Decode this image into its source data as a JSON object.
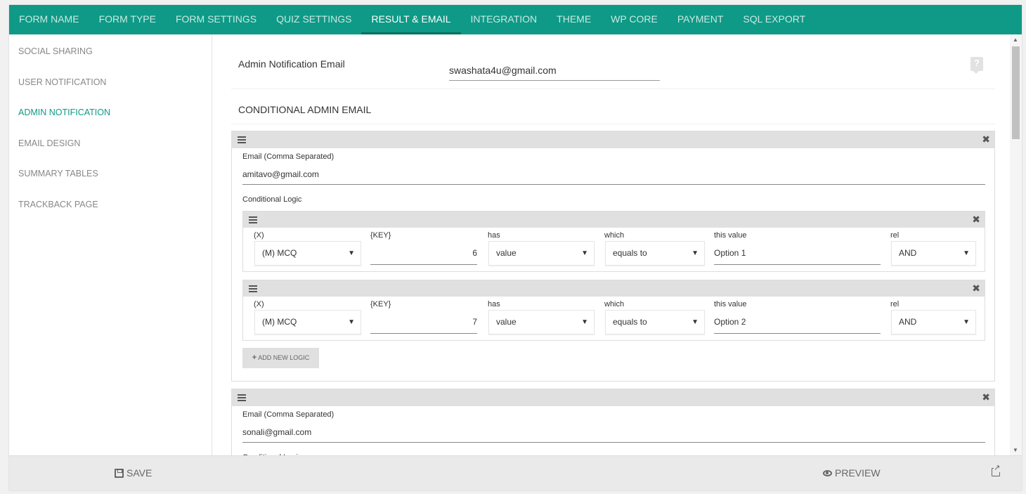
{
  "tabs": [
    {
      "label": "FORM NAME"
    },
    {
      "label": "FORM TYPE"
    },
    {
      "label": "FORM SETTINGS"
    },
    {
      "label": "QUIZ SETTINGS"
    },
    {
      "label": "RESULT & EMAIL",
      "active": true
    },
    {
      "label": "INTEGRATION"
    },
    {
      "label": "THEME"
    },
    {
      "label": "WP CORE"
    },
    {
      "label": "PAYMENT"
    },
    {
      "label": "SQL EXPORT"
    }
  ],
  "sidebar": {
    "items": [
      {
        "label": "SOCIAL SHARING"
      },
      {
        "label": "USER NOTIFICATION"
      },
      {
        "label": "ADMIN NOTIFICATION",
        "active": true
      },
      {
        "label": "EMAIL DESIGN"
      },
      {
        "label": "SUMMARY TABLES"
      },
      {
        "label": "TRACKBACK PAGE"
      }
    ]
  },
  "admin": {
    "label": "Admin Notification Email",
    "value": "swashata4u@gmail.com",
    "help_icon": "?"
  },
  "conditional": {
    "title": "CONDITIONAL ADMIN EMAIL",
    "email_label": "Email (Comma Separated)",
    "logic_label": "Conditional Logic",
    "columns": {
      "x": "(X)",
      "key": "{KEY}",
      "has": "has",
      "which": "which",
      "value": "this value",
      "rel": "rel"
    },
    "add_logic": "ADD NEW LOGIC",
    "blocks": [
      {
        "email": "amitavo@gmail.com",
        "logics": [
          {
            "x": "(M) MCQ",
            "key": "6",
            "has": "value",
            "which": "equals to",
            "value": "Option 1",
            "rel": "AND"
          },
          {
            "x": "(M) MCQ",
            "key": "7",
            "has": "value",
            "which": "equals to",
            "value": "Option 2",
            "rel": "AND"
          }
        ]
      },
      {
        "email": "sonali@gmail.com",
        "logics": []
      }
    ]
  },
  "footer": {
    "save": "SAVE",
    "preview": "PREVIEW"
  },
  "icons": {
    "close": "✖",
    "caret": "▼",
    "plus": "+"
  }
}
